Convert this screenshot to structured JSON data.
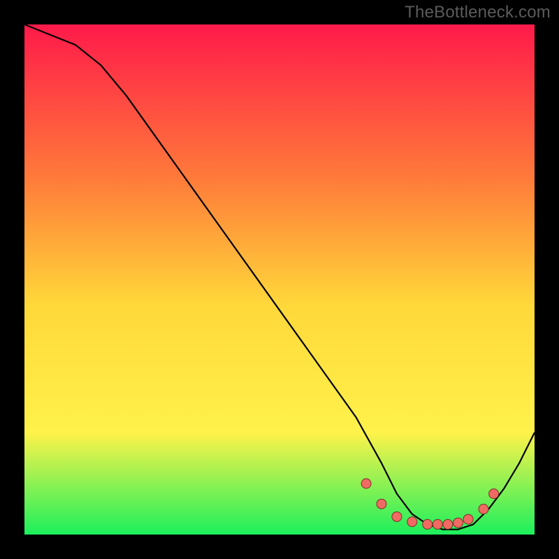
{
  "watermark": "TheBottleneck.com",
  "colors": {
    "gradient_top": "#ff1a4a",
    "gradient_mid1": "#ff7a3a",
    "gradient_mid2": "#ffd83a",
    "gradient_mid3": "#fff24a",
    "gradient_bottom": "#1cf05c",
    "curve": "#000000",
    "marker": "#ef6a62",
    "marker_stroke": "#7a2f2a"
  },
  "chart_data": {
    "type": "line",
    "title": "",
    "xlabel": "",
    "ylabel": "",
    "xlim": [
      0,
      100
    ],
    "ylim": [
      0,
      100
    ],
    "curve": {
      "x": [
        0,
        5,
        10,
        15,
        20,
        25,
        30,
        35,
        40,
        45,
        50,
        55,
        60,
        65,
        70,
        73,
        76,
        79,
        82,
        85,
        88,
        91,
        94,
        97,
        100
      ],
      "y": [
        100,
        98,
        96,
        92,
        86,
        79,
        72,
        65,
        58,
        51,
        44,
        37,
        30,
        23,
        14,
        8,
        4,
        2,
        1,
        1,
        2,
        5,
        9,
        14,
        20
      ]
    },
    "markers": {
      "x": [
        67,
        70,
        73,
        76,
        79,
        81,
        83,
        85,
        87,
        90,
        92
      ],
      "y": [
        10,
        6,
        3.5,
        2.5,
        2,
        2,
        2,
        2.3,
        3,
        5,
        8
      ]
    }
  }
}
